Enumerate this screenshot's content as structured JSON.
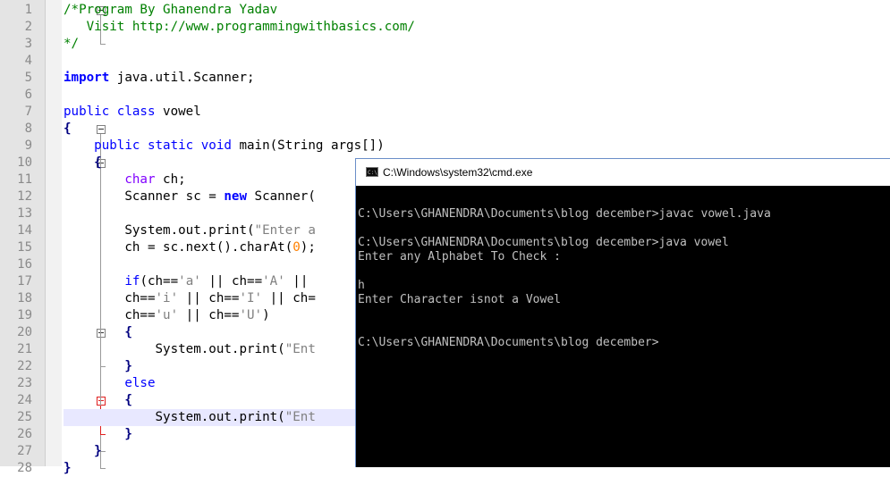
{
  "editor": {
    "line_numbers": [
      "1",
      "2",
      "3",
      "4",
      "5",
      "6",
      "7",
      "8",
      "9",
      "10",
      "11",
      "12",
      "13",
      "14",
      "15",
      "16",
      "17",
      "18",
      "19",
      "20",
      "21",
      "22",
      "23",
      "24",
      "25",
      "26",
      "27",
      "28"
    ],
    "lines": [
      [
        {
          "t": "/*Program By Ghanendra Yadav",
          "c": "cm"
        }
      ],
      [
        {
          "t": "   Visit http://www.programmingwithbasics.com/",
          "c": "cm"
        }
      ],
      [
        {
          "t": "*/",
          "c": "cm"
        }
      ],
      [],
      [
        {
          "t": "import",
          "c": "kwb"
        },
        {
          "t": " java.util.Scanner;",
          "c": ""
        }
      ],
      [],
      [
        {
          "t": "public",
          "c": "kw"
        },
        {
          "t": " ",
          "c": ""
        },
        {
          "t": "class",
          "c": "kw"
        },
        {
          "t": " vowel",
          "c": ""
        }
      ],
      [
        {
          "t": "{",
          "c": "op"
        }
      ],
      [
        {
          "t": "    ",
          "c": ""
        },
        {
          "t": "public",
          "c": "kw"
        },
        {
          "t": " ",
          "c": ""
        },
        {
          "t": "static",
          "c": "kw"
        },
        {
          "t": " ",
          "c": ""
        },
        {
          "t": "void",
          "c": "kw"
        },
        {
          "t": " main(String args[])",
          "c": ""
        }
      ],
      [
        {
          "t": "    {",
          "c": "op"
        }
      ],
      [
        {
          "t": "        ",
          "c": ""
        },
        {
          "t": "char",
          "c": "kwp"
        },
        {
          "t": " ch;",
          "c": ""
        }
      ],
      [
        {
          "t": "        Scanner sc = ",
          "c": ""
        },
        {
          "t": "new",
          "c": "kwb"
        },
        {
          "t": " Scanner(",
          "c": ""
        }
      ],
      [],
      [
        {
          "t": "        System.out.print(",
          "c": ""
        },
        {
          "t": "\"Enter a",
          "c": "st"
        }
      ],
      [
        {
          "t": "        ch = sc.next().charAt(",
          "c": ""
        },
        {
          "t": "0",
          "c": "num"
        },
        {
          "t": ");",
          "c": ""
        }
      ],
      [],
      [
        {
          "t": "        ",
          "c": ""
        },
        {
          "t": "if",
          "c": "kw"
        },
        {
          "t": "(ch==",
          "c": ""
        },
        {
          "t": "'a'",
          "c": "st"
        },
        {
          "t": " || ch==",
          "c": ""
        },
        {
          "t": "'A'",
          "c": "st"
        },
        {
          "t": " ||",
          "c": ""
        }
      ],
      [
        {
          "t": "        ch==",
          "c": ""
        },
        {
          "t": "'i'",
          "c": "st"
        },
        {
          "t": " || ch==",
          "c": ""
        },
        {
          "t": "'I'",
          "c": "st"
        },
        {
          "t": " || ch=",
          "c": ""
        }
      ],
      [
        {
          "t": "        ch==",
          "c": ""
        },
        {
          "t": "'u'",
          "c": "st"
        },
        {
          "t": " || ch==",
          "c": ""
        },
        {
          "t": "'U'",
          "c": "st"
        },
        {
          "t": ")",
          "c": ""
        }
      ],
      [
        {
          "t": "        {",
          "c": "op"
        }
      ],
      [
        {
          "t": "            System.out.print(",
          "c": ""
        },
        {
          "t": "\"Ent",
          "c": "st"
        }
      ],
      [
        {
          "t": "        }",
          "c": "op"
        }
      ],
      [
        {
          "t": "        ",
          "c": ""
        },
        {
          "t": "else",
          "c": "kw"
        }
      ],
      [
        {
          "t": "        {",
          "c": "op"
        }
      ],
      [
        {
          "t": "            System.out.print(",
          "c": ""
        },
        {
          "t": "\"Ent",
          "c": "st"
        }
      ],
      [
        {
          "t": "        }",
          "c": "op"
        }
      ],
      [
        {
          "t": "    }",
          "c": "op"
        }
      ],
      [
        {
          "t": "}",
          "c": "op"
        }
      ]
    ]
  },
  "console": {
    "title": "C:\\Windows\\system32\\cmd.exe",
    "icon": "cmd-icon",
    "icon_text": "C:\\",
    "output_lines": [
      "",
      "C:\\Users\\GHANENDRA\\Documents\\blog december>javac vowel.java",
      "",
      "C:\\Users\\GHANENDRA\\Documents\\blog december>java vowel",
      "Enter any Alphabet To Check :",
      "",
      "h",
      "Enter Character isnot a Vowel",
      "",
      "",
      "C:\\Users\\GHANENDRA\\Documents\\blog december>"
    ]
  },
  "colors": {
    "comment": "#008000",
    "keyword": "#0000ff",
    "type_keyword": "#8000ff",
    "string": "#808080",
    "number": "#ff8000",
    "console_bg": "#000000",
    "console_text": "#c0c0c0",
    "current_line": "#e8e8ff"
  }
}
